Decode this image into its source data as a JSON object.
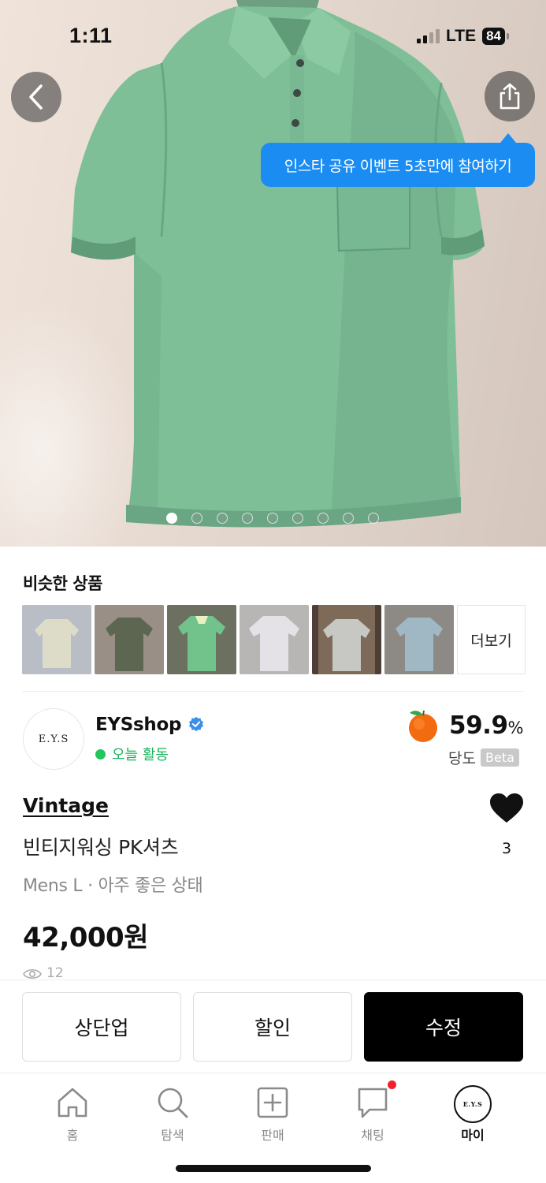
{
  "status_bar": {
    "time": "1:11",
    "network": "LTE",
    "battery": "84"
  },
  "hero": {
    "tooltip": "인스타 공유 이벤트 5초만에 참여하기",
    "image_count": 9,
    "active_index": 0
  },
  "similar": {
    "title": "비슷한 상품",
    "more_label": "더보기",
    "thumbnail_count": 6
  },
  "seller": {
    "name": "EYSshop",
    "avatar_text": "E.Y.S",
    "activity": "오늘 활동",
    "sweetness_value": "59.9",
    "sweetness_unit": "%",
    "sweetness_label": "당도",
    "beta_badge": "Beta"
  },
  "product": {
    "brand": "Vintage",
    "name": "빈티지워싱 PK셔츠",
    "meta": "Mens L · 아주 좋은 상태",
    "price": "42,000원",
    "likes": "3",
    "views": "12"
  },
  "actions": {
    "bump": "상단업",
    "discount": "할인",
    "edit": "수정"
  },
  "tabbar": {
    "home": "홈",
    "search": "탐색",
    "sell": "판매",
    "chat": "채팅",
    "my": "마이",
    "my_avatar_text": "E.Y.S"
  },
  "colors": {
    "accent_blue": "#1b8df2",
    "online_green": "#22c55e",
    "shirt_green": "#7fbf98",
    "notification_red": "#f0212f"
  }
}
